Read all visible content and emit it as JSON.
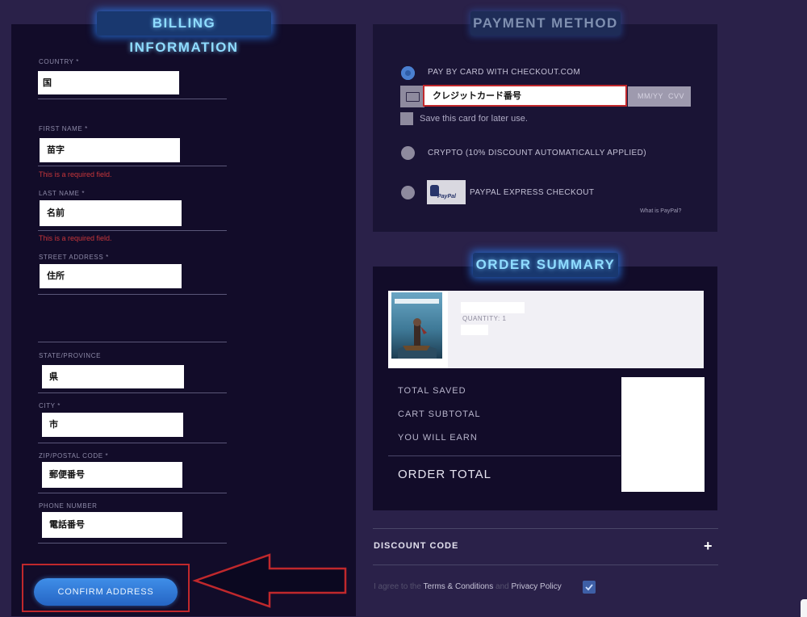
{
  "billing": {
    "title": "BILLING INFORMATION",
    "fields": {
      "country": {
        "label": "COUNTRY *",
        "value": "国"
      },
      "first_name": {
        "label": "FIRST NAME *",
        "value": "苗字",
        "error": "This is a required field."
      },
      "last_name": {
        "label": "LAST NAME *",
        "value": "名前",
        "error": "This is a required field."
      },
      "street": {
        "label": "STREET ADDRESS *",
        "value": "住所"
      },
      "state": {
        "label": "STATE/PROVINCE",
        "value": "県"
      },
      "city": {
        "label": "CITY *",
        "value": "市"
      },
      "zip": {
        "label": "ZIP/POSTAL CODE *",
        "value": "郵便番号"
      },
      "phone": {
        "label": "PHONE NUMBER",
        "value": "電話番号"
      }
    },
    "confirm_label": "CONFIRM ADDRESS"
  },
  "payment": {
    "title": "PAYMENT METHOD",
    "options": {
      "card": "PAY BY CARD WITH CHECKOUT.COM",
      "crypto": "CRYPTO (10% DISCOUNT AUTOMATICALLY APPLIED)",
      "paypal": "PAYPAL EXPRESS CHECKOUT"
    },
    "card_number_value": "クレジットカード番号",
    "expiry_placeholder": "MM/YY",
    "cvv_placeholder": "CVV",
    "save_card_label": "Save this card for later use.",
    "paypal_logo_text": "PayPal",
    "what_is_paypal": "What is PayPal?"
  },
  "order": {
    "title": "ORDER SUMMARY",
    "item": {
      "quantity_label": "QUANTITY: 1"
    },
    "totals": {
      "total_saved": "TOTAL SAVED",
      "cart_subtotal": "CART SUBTOTAL",
      "you_will_earn": "YOU WILL EARN",
      "order_total": "ORDER TOTAL"
    }
  },
  "discount": {
    "label": "DISCOUNT CODE",
    "toggle": "+"
  },
  "terms": {
    "prefix": "I agree to the",
    "terms_link": "Terms & Conditions",
    "and": "and",
    "privacy_link": "Privacy Policy"
  },
  "colors": {
    "accent": "#2f6fd6",
    "error": "#c8363a",
    "annotation": "#c0282c"
  }
}
